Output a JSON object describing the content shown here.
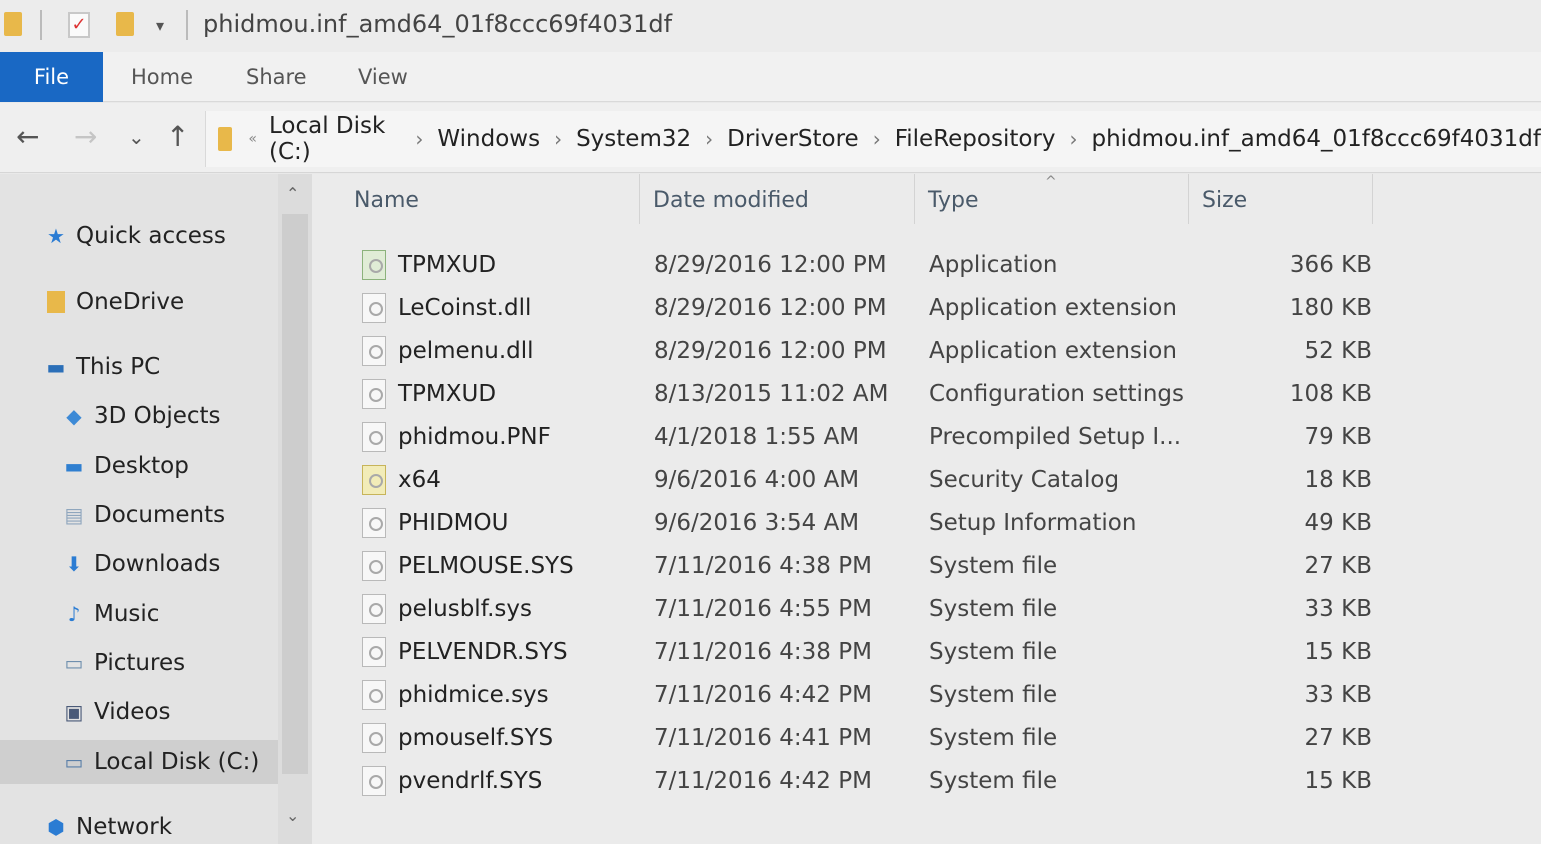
{
  "window": {
    "title": "phidmou.inf_amd64_01f8ccc69f4031df"
  },
  "ribbon": {
    "tabs": [
      "File",
      "Home",
      "Share",
      "View"
    ]
  },
  "nav": {
    "back": "←",
    "forward": "→",
    "recent": "⌄",
    "up": "↑"
  },
  "address": {
    "more": "«",
    "crumbs": [
      "Local Disk (C:)",
      "Windows",
      "System32",
      "DriverStore",
      "FileRepository",
      "phidmou.inf_amd64_01f8ccc69f4031df"
    ]
  },
  "sidebar": {
    "items": [
      {
        "label": "Quick access",
        "icon": "star-icon"
      },
      {
        "label": "OneDrive",
        "icon": "onedrive-icon"
      },
      {
        "label": "This PC",
        "icon": "pc-icon"
      },
      {
        "label": "3D Objects",
        "icon": "3d-objects-icon"
      },
      {
        "label": "Desktop",
        "icon": "desktop-icon"
      },
      {
        "label": "Documents",
        "icon": "documents-icon"
      },
      {
        "label": "Downloads",
        "icon": "downloads-icon"
      },
      {
        "label": "Music",
        "icon": "music-icon"
      },
      {
        "label": "Pictures",
        "icon": "pictures-icon"
      },
      {
        "label": "Videos",
        "icon": "videos-icon"
      },
      {
        "label": "Local Disk (C:)",
        "icon": "drive-icon"
      },
      {
        "label": "Network",
        "icon": "network-icon"
      }
    ],
    "selected": "Local Disk (C:)"
  },
  "columns": {
    "name": "Name",
    "date": "Date modified",
    "type": "Type",
    "size": "Size"
  },
  "files": [
    {
      "name": "TPMXUD",
      "date": "8/29/2016 12:00 PM",
      "type": "Application",
      "size": "366 KB",
      "icon": "application-icon"
    },
    {
      "name": "LeCoinst.dll",
      "date": "8/29/2016 12:00 PM",
      "type": "Application extension",
      "size": "180 KB",
      "icon": "dll-icon"
    },
    {
      "name": "pelmenu.dll",
      "date": "8/29/2016 12:00 PM",
      "type": "Application extension",
      "size": "52 KB",
      "icon": "dll-icon"
    },
    {
      "name": "TPMXUD",
      "date": "8/13/2015 11:02 AM",
      "type": "Configuration settings",
      "size": "108 KB",
      "icon": "config-icon"
    },
    {
      "name": "phidmou.PNF",
      "date": "4/1/2018 1:55 AM",
      "type": "Precompiled Setup I...",
      "size": "79 KB",
      "icon": "pnf-icon"
    },
    {
      "name": "x64",
      "date": "9/6/2016 4:00 AM",
      "type": "Security Catalog",
      "size": "18 KB",
      "icon": "catalog-icon"
    },
    {
      "name": "PHIDMOU",
      "date": "9/6/2016 3:54 AM",
      "type": "Setup Information",
      "size": "49 KB",
      "icon": "inf-icon"
    },
    {
      "name": "PELMOUSE.SYS",
      "date": "7/11/2016 4:38 PM",
      "type": "System file",
      "size": "27 KB",
      "icon": "system-file-icon"
    },
    {
      "name": "pelusblf.sys",
      "date": "7/11/2016 4:55 PM",
      "type": "System file",
      "size": "33 KB",
      "icon": "system-file-icon"
    },
    {
      "name": "PELVENDR.SYS",
      "date": "7/11/2016 4:38 PM",
      "type": "System file",
      "size": "15 KB",
      "icon": "system-file-icon"
    },
    {
      "name": "phidmice.sys",
      "date": "7/11/2016 4:42 PM",
      "type": "System file",
      "size": "33 KB",
      "icon": "system-file-icon"
    },
    {
      "name": "pmouself.SYS",
      "date": "7/11/2016 4:41 PM",
      "type": "System file",
      "size": "27 KB",
      "icon": "system-file-icon"
    },
    {
      "name": "pvendrlf.SYS",
      "date": "7/11/2016 4:42 PM",
      "type": "System file",
      "size": "15 KB",
      "icon": "system-file-icon"
    }
  ],
  "scrollbar": {
    "up": "⌃",
    "down": "⌄"
  },
  "colors": {
    "file_tab": "#1968c4",
    "folder": "#e8b84a",
    "quick_access_star": "#2b7cd3"
  }
}
